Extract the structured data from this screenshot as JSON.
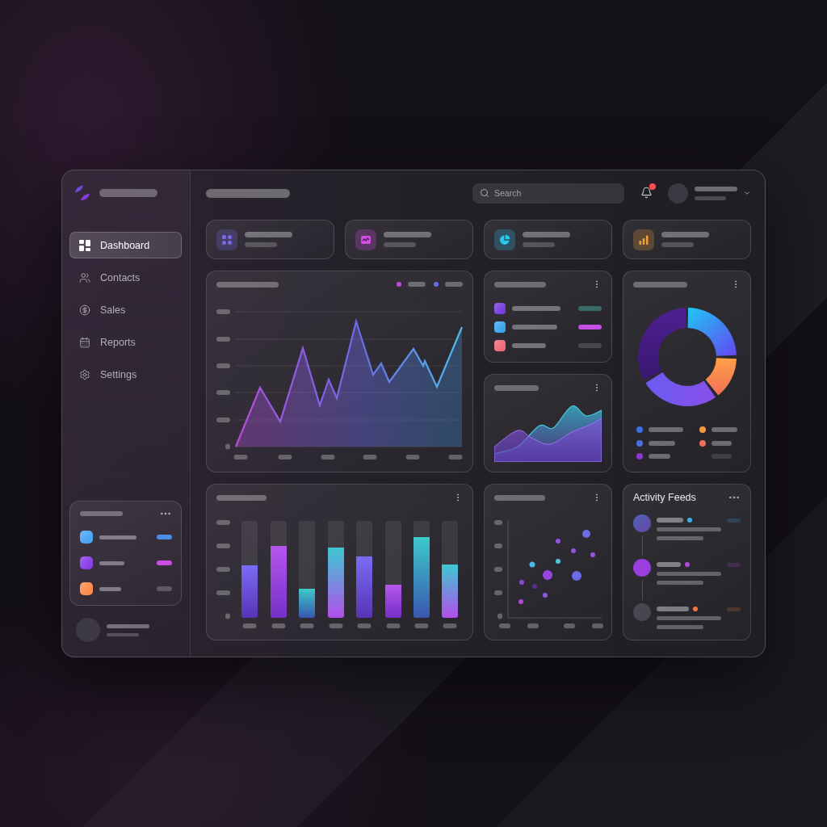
{
  "sidebar": {
    "nav": [
      {
        "label": "Dashboard",
        "selected": true
      },
      {
        "label": "Contacts",
        "selected": false
      },
      {
        "label": "Sales",
        "selected": false
      },
      {
        "label": "Reports",
        "selected": false
      },
      {
        "label": "Settings",
        "selected": false
      }
    ],
    "widget": {
      "items": [
        {
          "color": "#4aa6f2",
          "tag": {
            "color": "#4a8ee8"
          }
        },
        {
          "color": "#8a3ee8",
          "tag": {
            "color": "#cc4ee2"
          }
        },
        {
          "color": "#ff8c4a",
          "tag": {
            "color": "#5c5a62"
          }
        }
      ]
    }
  },
  "topbar": {
    "search": {
      "placeholder": "Search"
    },
    "notifications": {
      "unread": true
    }
  },
  "stat_cards": [
    {
      "color": "#7a6ae8"
    },
    {
      "color": "#d24ee0"
    },
    {
      "color": "#2ec4f0"
    },
    {
      "color": "#f0a040"
    }
  ],
  "line_chart": {
    "legend": [
      {
        "color": "#b84ee0"
      },
      {
        "color": "#6a6ce8"
      }
    ]
  },
  "list_card": {
    "items": [
      {
        "color": "#7a3ee0",
        "tag": {
          "color": "#3a6a68"
        }
      },
      {
        "color": "#3aa8f0",
        "tag": {
          "color": "#c44ee6"
        }
      },
      {
        "color": "#f06a7a",
        "tag": {
          "color": "#48474d"
        }
      }
    ]
  },
  "donut_card": {
    "legend": [
      {
        "color": "#3a6fe8",
        "muted": false
      },
      {
        "color": "#4a70e0",
        "muted": false
      },
      {
        "color": "#8a35d0",
        "muted": false
      },
      {
        "color": "#f59a40",
        "muted": false
      },
      {
        "color": "#f07060",
        "muted": false
      },
      {
        "muted": true
      }
    ]
  },
  "activity_feed": {
    "title": "Activity Feeds",
    "items": [
      {
        "color": "#3ab0f0"
      },
      {
        "color": "#b04ae0"
      },
      {
        "color": "#f07a40"
      }
    ]
  }
}
